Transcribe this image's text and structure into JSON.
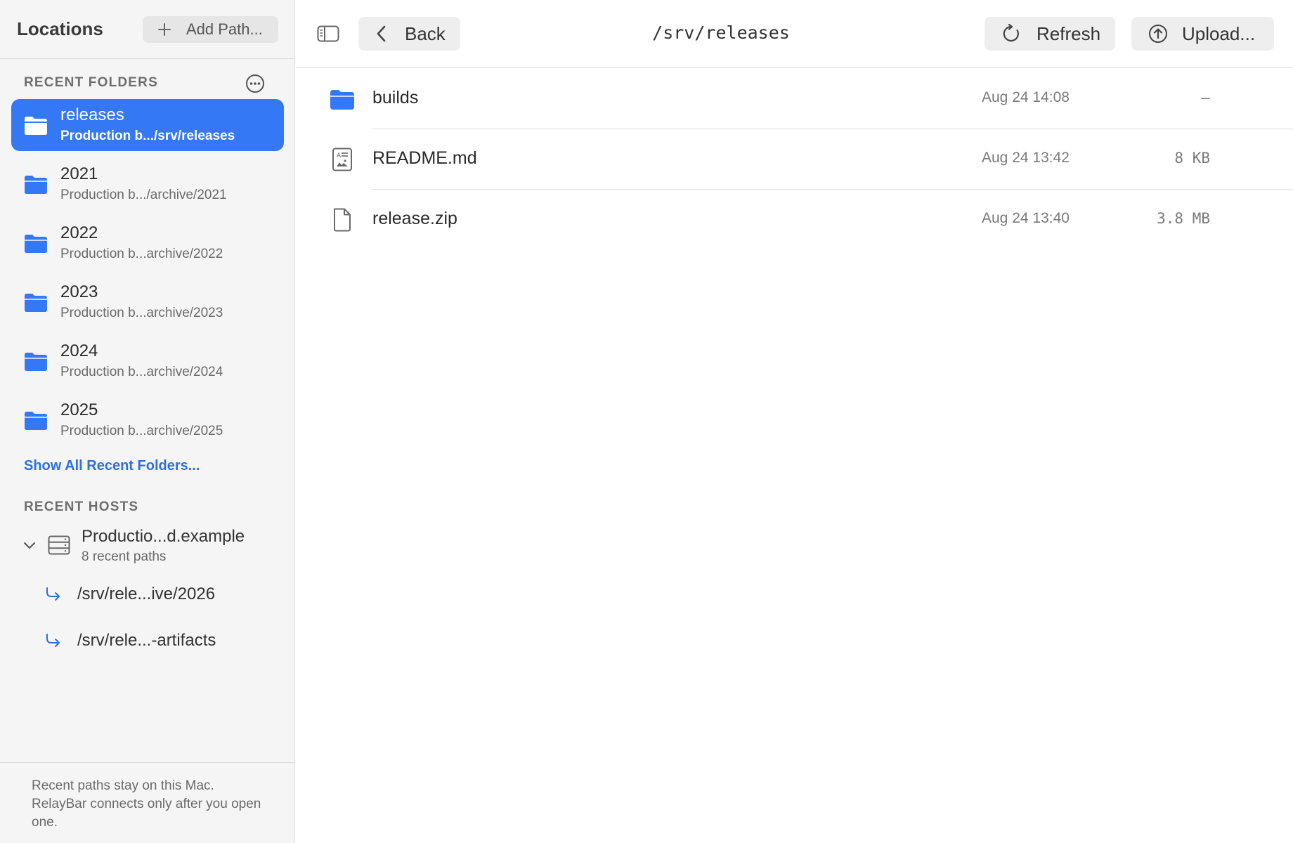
{
  "sidebar": {
    "title": "Locations",
    "add_path_label": "Add Path...",
    "recent_folders_label": "RECENT FOLDERS",
    "folders": [
      {
        "name": "releases",
        "path": "Production b.../srv/releases",
        "selected": true
      },
      {
        "name": "2021",
        "path": "Production b.../archive/2021",
        "selected": false
      },
      {
        "name": "2022",
        "path": "Production b...archive/2022",
        "selected": false
      },
      {
        "name": "2023",
        "path": "Production b...archive/2023",
        "selected": false
      },
      {
        "name": "2024",
        "path": "Production b...archive/2024",
        "selected": false
      },
      {
        "name": "2025",
        "path": "Production b...archive/2025",
        "selected": false
      }
    ],
    "show_all_label": "Show All Recent Folders...",
    "recent_hosts_label": "RECENT HOSTS",
    "host": {
      "name": "Productio...d.example",
      "subtitle": "8 recent paths"
    },
    "host_paths": [
      "/srv/rele...ive/2026",
      "/srv/rele...-artifacts"
    ],
    "footer_text": "Recent paths stay on this Mac. RelayBar connects only after you open one."
  },
  "toolbar": {
    "back_label": "Back",
    "current_path": "/srv/releases",
    "refresh_label": "Refresh",
    "upload_label": "Upload..."
  },
  "files": [
    {
      "name": "builds",
      "date": "Aug 24 14:08",
      "size": "–",
      "kind": "folder-icon"
    },
    {
      "name": "README.md",
      "date": "Aug 24 13:42",
      "size": "8 KB",
      "kind": "text-document-icon"
    },
    {
      "name": "release.zip",
      "date": "Aug 24 13:40",
      "size": "3.8 MB",
      "kind": "document-icon"
    }
  ],
  "colors": {
    "accent": "#3478f6",
    "link": "#2f6fe0",
    "sidebar_bg": "#f5f5f5"
  }
}
